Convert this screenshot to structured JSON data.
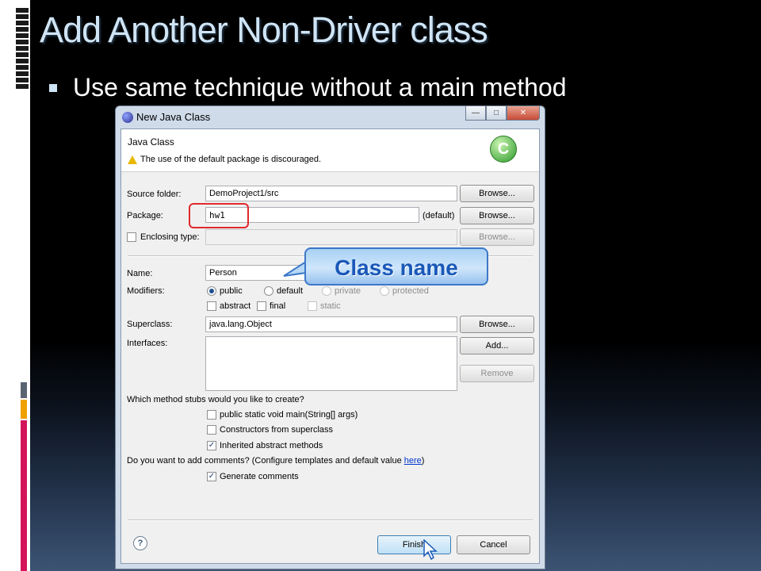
{
  "slide": {
    "title": "Add Another Non-Driver class",
    "bullet": "Use same technique without a main method"
  },
  "dialog": {
    "window_title": "New Java Class",
    "header_title": "Java Class",
    "warning": "The use of the default package is discouraged.",
    "class_icon_letter": "C",
    "source_folder": {
      "label": "Source folder:",
      "value": "DemoProject1/src",
      "button": "Browse..."
    },
    "package": {
      "label": "Package:",
      "value": "hw1",
      "suffix": "(default)",
      "button": "Browse..."
    },
    "enclosing_type": {
      "label": "Enclosing type:",
      "value": "",
      "button": "Browse...",
      "checked": false
    },
    "name": {
      "label": "Name:",
      "value": "Person"
    },
    "modifiers": {
      "label": "Modifiers:",
      "access": [
        "public",
        "default",
        "private",
        "protected"
      ],
      "selected": "public",
      "flags": [
        "abstract",
        "final",
        "static"
      ]
    },
    "superclass": {
      "label": "Superclass:",
      "value": "java.lang.Object",
      "button": "Browse..."
    },
    "interfaces": {
      "label": "Interfaces:",
      "add_button": "Add...",
      "remove_button": "Remove"
    },
    "stubs": {
      "question": "Which method stubs would you like to create?",
      "options": [
        {
          "label": "public static void main(String[] args)",
          "checked": false
        },
        {
          "label": "Constructors from superclass",
          "checked": false
        },
        {
          "label": "Inherited abstract methods",
          "checked": true
        }
      ]
    },
    "comments": {
      "question": "Do you want to add comments? (Configure templates and default value ",
      "link": "here",
      "close": ")",
      "option": "Generate comments",
      "checked": true
    },
    "help_symbol": "?",
    "finish_button": "Finish",
    "cancel_button": "Cancel"
  },
  "callout": {
    "text": "Class name"
  },
  "colors": {
    "title_text": "#cfe4f4",
    "callout_text": "#1a58b8",
    "highlight_border": "#e0282c",
    "bar_gray": "#5a6470",
    "bar_orange": "#f0a000",
    "bar_pink": "#d4145a"
  }
}
